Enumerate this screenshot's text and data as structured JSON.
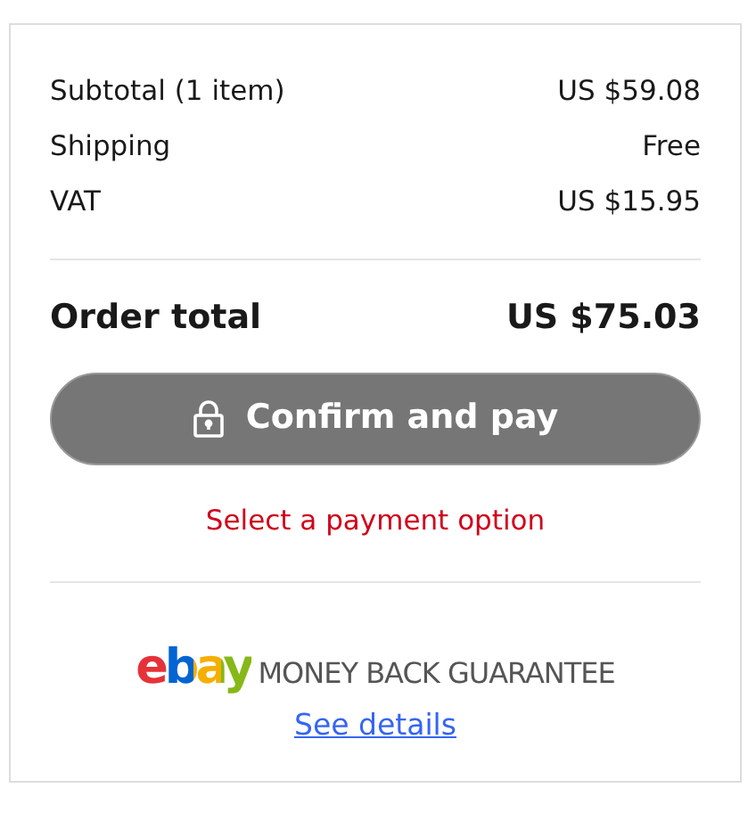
{
  "summary": [
    {
      "label": "Subtotal (1 item)",
      "value": "US $59.08"
    },
    {
      "label": "Shipping",
      "value": "Free"
    },
    {
      "label": "VAT",
      "value": "US $15.95"
    }
  ],
  "total": {
    "label": "Order total",
    "value": "US $75.03"
  },
  "pay_button": {
    "label": "Confirm and pay",
    "disabled": true
  },
  "error": "Select a payment option",
  "guarantee": {
    "logo": "ebay",
    "text": "MONEY BACK GUARANTEE",
    "link": "See details"
  }
}
